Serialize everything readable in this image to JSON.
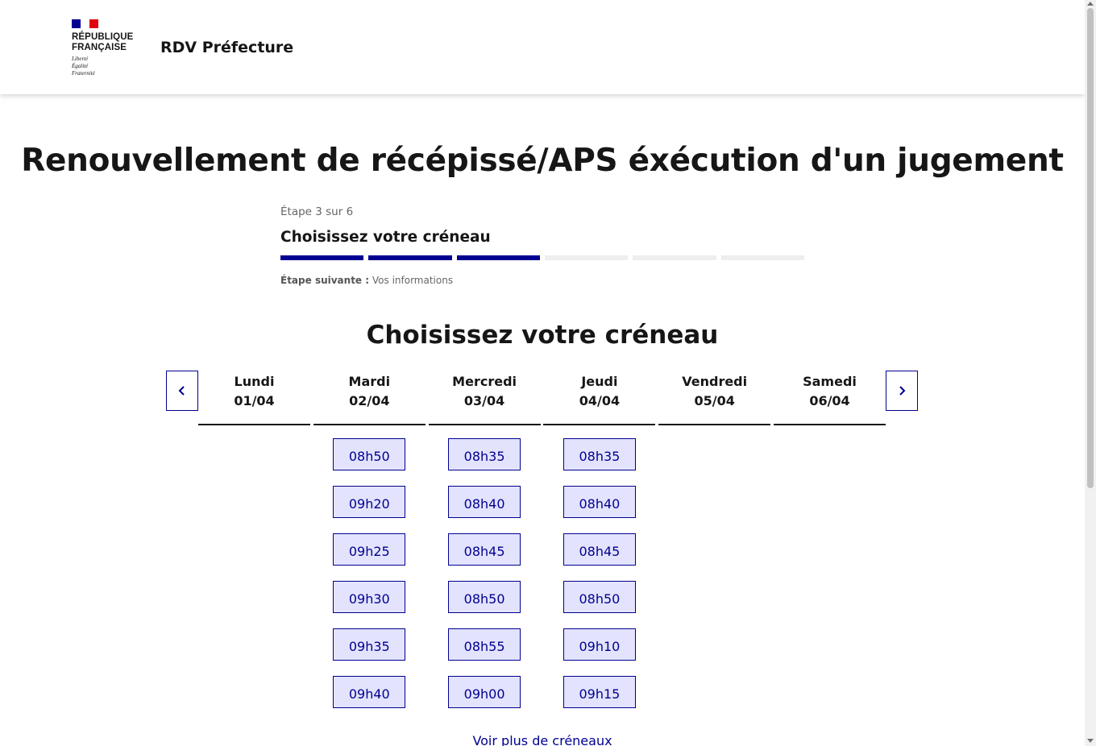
{
  "header": {
    "logo_line1": "RÉPUBLIQUE",
    "logo_line2": "FRANÇAISE",
    "motto1": "Liberté",
    "motto2": "Égalité",
    "motto3": "Fraternité",
    "service_title": "RDV Préfecture",
    "flag_colors": [
      "#000091",
      "#ffffff",
      "#e1000f"
    ]
  },
  "page": {
    "title": "Renouvellement de récépissé/APS éxécution d'un jugement"
  },
  "stepper": {
    "state": "Étape 3 sur 6",
    "title": "Choisissez votre créneau",
    "current_step": 3,
    "total_steps": 6,
    "next_label": "Étape suivante :",
    "next_value": "Vos informations"
  },
  "calendar": {
    "title": "Choisissez votre créneau",
    "prev_icon": "chevron-left-icon",
    "next_icon": "chevron-right-icon",
    "days": [
      {
        "name": "Lundi",
        "date": "01/04",
        "slots": []
      },
      {
        "name": "Mardi",
        "date": "02/04",
        "slots": [
          "08h50",
          "09h20",
          "09h25",
          "09h30",
          "09h35",
          "09h40"
        ]
      },
      {
        "name": "Mercredi",
        "date": "03/04",
        "slots": [
          "08h35",
          "08h40",
          "08h45",
          "08h50",
          "08h55",
          "09h00"
        ]
      },
      {
        "name": "Jeudi",
        "date": "04/04",
        "slots": [
          "08h35",
          "08h40",
          "08h45",
          "08h50",
          "09h10",
          "09h15"
        ]
      },
      {
        "name": "Vendredi",
        "date": "05/04",
        "slots": []
      },
      {
        "name": "Samedi",
        "date": "06/04",
        "slots": []
      }
    ],
    "more_link": "Voir plus de créneaux",
    "accent_color": "#000091",
    "slot_background": "#e3e3fd"
  }
}
